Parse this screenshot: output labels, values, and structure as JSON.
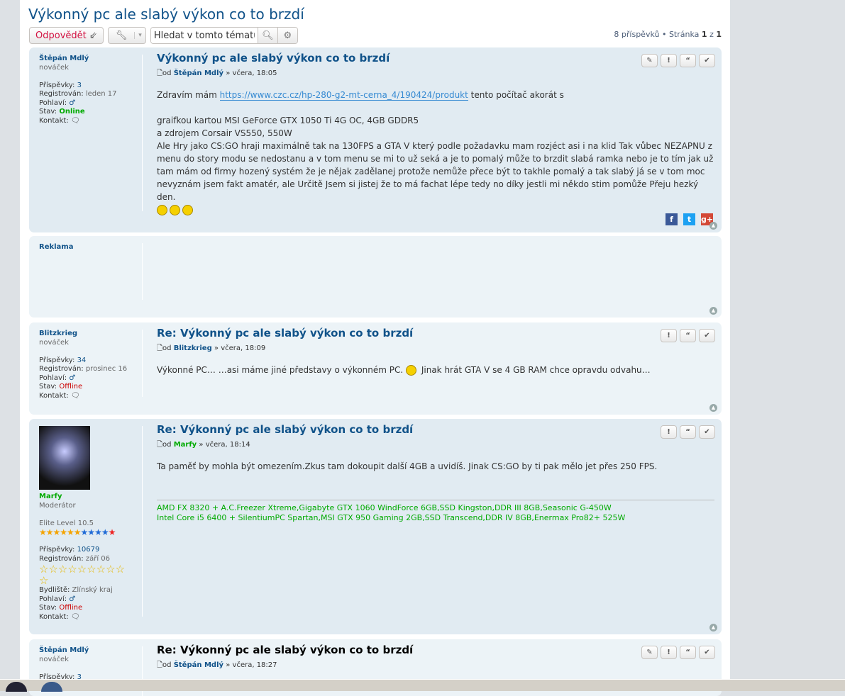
{
  "topic": {
    "title": "Výkonný pc ale slabý výkon co to brzdí",
    "reply": "Odpovědět",
    "search_placeholder": "Hledat v tomto tématu…",
    "search_value": "Hledat v tomto tématu",
    "posts_count": "8 příspěvků",
    "page_label": "Stránka",
    "page_current": "1",
    "page_of": "z",
    "page_total": "1"
  },
  "labels": {
    "posts": "Příspěvky:",
    "registered": "Registrován:",
    "gender": "Pohlaví:",
    "status": "Stav:",
    "contact": "Kontakt:",
    "residence": "Bydliště:",
    "by": "od",
    "sep": "»"
  },
  "posts": [
    {
      "user": "Štěpán Mdlý",
      "rank": "nováček",
      "posts": "3",
      "registered": "leden 17",
      "status": "Online",
      "title": "Výkonný pc ale slabý výkon co to brzdí",
      "time": "včera, 18:05",
      "text_before": "Zdravím mám ",
      "link": "https://www.czc.cz/hp-280-g2-mt-cerna_4/190424/produkt",
      "text_after": " tento počítač akorát s",
      "lines": [
        "graifkou kartou MSI GeForce GTX 1050 Ti 4G OC, 4GB GDDR5",
        "a zdrojem Corsair VS550, 550W",
        "Ale Hry jako CS:GO hraji maximálně tak na 130FPS a GTA V který podle požadavku mam rozjéct asi i na klid Tak vůbec NEZAPNU z menu do story modu se nedostanu a v tom menu se mi to už seká a je to pomalý může to brzdit slabá ramka nebo je to tím jak už tam mám od firmy hozený systém že je nějak zadělanej protože nemůže přece být to takhle pomalý a tak slabý já se v tom moc nevyznám jsem fakt amatér, ale Určitě Jsem si jistej že to má fachat lépe tedy no díky jestli mi někdo stim pomůže Přeju hezký den."
      ]
    },
    {
      "user": "Reklama"
    },
    {
      "user": "Blitzkrieg",
      "rank": "nováček",
      "posts": "34",
      "registered": "prosinec 16",
      "status": "Offline",
      "title": "Re: Výkonný pc ale slabý výkon co to brzdí",
      "time": "včera, 18:09",
      "text_before": "Výkonné PC… …asi máme jiné představy o výkonném PC. ",
      "text_after": " Jinak hrát GTA V se 4 GB RAM chce opravdu odvahu…"
    },
    {
      "user": "Marfy",
      "rank": "Moderátor",
      "level": "Elite Level 10.5",
      "posts": "10679",
      "registered": "září 06",
      "residence": "Zlínský kraj",
      "status": "Offline",
      "title": "Re: Výkonný pc ale slabý výkon co to brzdí",
      "time": "včera, 18:14",
      "text": "Ta paměť by mohla být omezením.Zkus tam dokoupit další 4GB a uvidíš. Jinak CS:GO by ti pak mělo jet přes 250 FPS.",
      "sig": [
        "AMD FX 8320 + A.C.Freezer Xtreme,Gigabyte GTX 1060 WindForce 6GB,SSD Kingston,DDR III 8GB,Seasonic G-450W",
        "Intel Core i5 6400 + SilentiumPC Spartan,MSI GTX 950 Gaming 2GB,SSD Transcend,DDR IV 8GB,Enermax Pro82+ 525W"
      ]
    },
    {
      "user": "Štěpán Mdlý",
      "rank": "nováček",
      "posts": "3",
      "title": "Re: Výkonný pc ale slabý výkon co to brzdí",
      "time": "včera, 18:27"
    }
  ]
}
